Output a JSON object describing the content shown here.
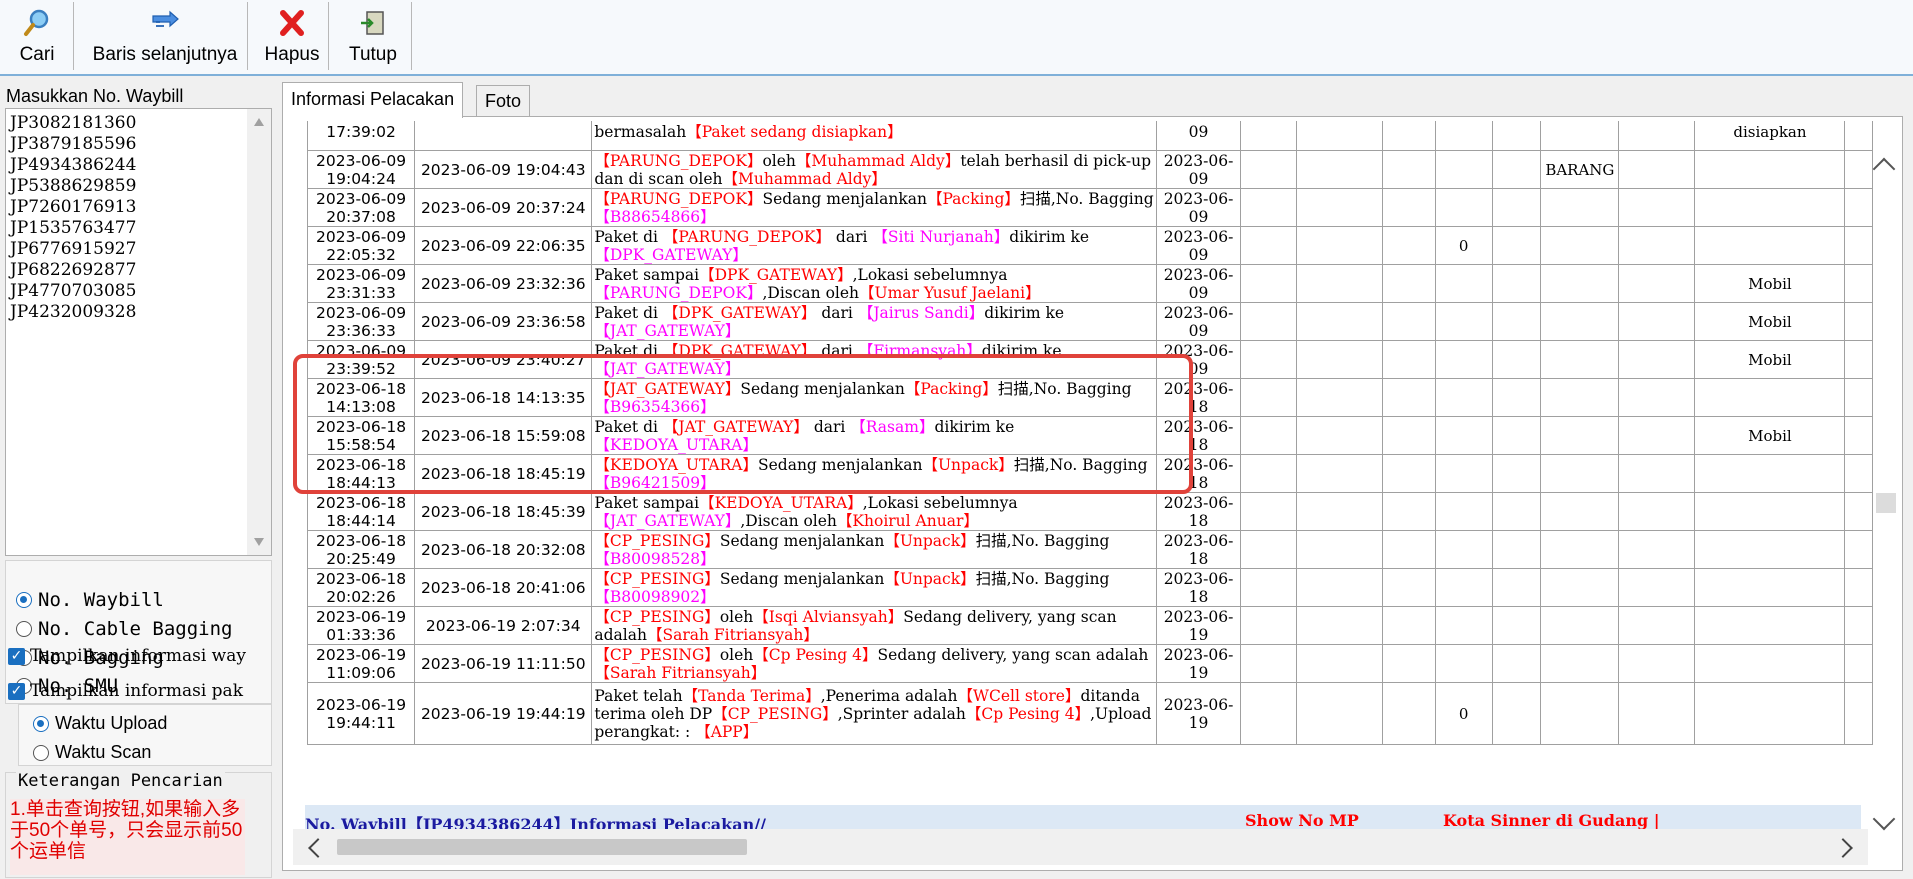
{
  "toolbar": {
    "cari": "Cari",
    "baris": "Baris selanjutnya",
    "hapus": "Hapus",
    "tutup": "Tutup"
  },
  "left": {
    "waybill_caption": "Masukkan No. Waybill",
    "waybills": [
      "JP3082181360",
      "JP3879185596",
      "JP4934386244",
      "JP5388629859",
      "JP7260176913",
      "JP1535763477",
      "JP6776915927",
      "JP6822692877",
      "JP4770703085",
      "JP4232009328"
    ],
    "radio_options": [
      "No. Waybill",
      "No. Cable Bagging",
      "No. Bagging",
      "No. SMU"
    ],
    "check1": "Tampilkan informasi way",
    "check2": "Tampilkan informasi pak",
    "time_options": [
      "Waktu Upload",
      "Waktu Scan"
    ],
    "ket_title": "Keterangan Pencarian",
    "ket_text": "1.单击查询按钮,如果输入多于50个单号，只会显示前50个运单信"
  },
  "tabs": [
    "Informasi Pelacakan",
    "Foto"
  ],
  "rows": [
    {
      "t1a": "",
      "t1b": "17:39:02",
      "t2": "",
      "desc": [
        [
          "k",
          "bermasalah"
        ],
        [
          "r",
          "【Paket sedang disiapkan】"
        ]
      ],
      "d3a": "09",
      "d3b": "",
      "ex": "disiapkan",
      "excol": 11,
      "exa": "",
      "exb": ""
    },
    {
      "t1a": "2023-06-09",
      "t1b": "19:04:24",
      "t2": "2023-06-09 19:04:43",
      "desc": [
        [
          "r",
          "【PARUNG_DEPOK】"
        ],
        [
          "k",
          "oleh"
        ],
        [
          "r",
          "【Muhammad Aldy】"
        ],
        [
          "k",
          "telah berhasil di pick-up dan di scan oleh"
        ],
        [
          "r",
          "【Muhammad Aldy】"
        ]
      ],
      "d3a": "2023-06-",
      "d3b": "09",
      "ex": "BARANG",
      "excol": 9
    },
    {
      "t1a": "2023-06-09",
      "t1b": "20:37:08",
      "t2": "2023-06-09 20:37:24",
      "desc": [
        [
          "r",
          "【PARUNG_DEPOK】"
        ],
        [
          "k",
          "Sedang menjalankan"
        ],
        [
          "r",
          "【Packing】"
        ],
        [
          "k",
          "扫描,No. Bagging"
        ],
        [
          "m",
          "【B88654866】"
        ]
      ],
      "d3a": "2023-06-",
      "d3b": "09",
      "ex": "",
      "excol": 0
    },
    {
      "t1a": "2023-06-09",
      "t1b": "22:05:32",
      "t2": "2023-06-09 22:06:35",
      "desc": [
        [
          "k",
          "Paket di "
        ],
        [
          "r",
          "【PARUNG_DEPOK】"
        ],
        [
          "k",
          " dari "
        ],
        [
          "m",
          "【Siti Nurjanah】"
        ],
        [
          "k",
          "dikirim ke"
        ],
        [
          "m",
          "【DPK_GATEWAY】"
        ]
      ],
      "d3a": "2023-06-",
      "d3b": "09",
      "ex": "0",
      "excol": 7
    },
    {
      "t1a": "2023-06-09",
      "t1b": "23:31:33",
      "t2": "2023-06-09 23:32:36",
      "desc": [
        [
          "k",
          "Paket sampai"
        ],
        [
          "r",
          "【DPK_GATEWAY】"
        ],
        [
          "k",
          ",Lokasi sebelumnya"
        ],
        [
          "m",
          "【PARUNG_DEPOK】"
        ],
        [
          "k",
          ",Discan oleh"
        ],
        [
          "r",
          "【Umar Yusuf Jaelani】"
        ]
      ],
      "d3a": "2023-06-",
      "d3b": "09",
      "ex": "Mobil",
      "excol": 11
    },
    {
      "t1a": "2023-06-09",
      "t1b": "23:36:33",
      "t2": "2023-06-09 23:36:58",
      "desc": [
        [
          "k",
          "Paket di "
        ],
        [
          "r",
          "【DPK_GATEWAY】"
        ],
        [
          "k",
          " dari "
        ],
        [
          "m",
          "【Jairus Sandi】"
        ],
        [
          "k",
          "dikirim ke"
        ],
        [
          "m",
          "【JAT_GATEWAY】"
        ]
      ],
      "d3a": "2023-06-",
      "d3b": "09",
      "ex": "Mobil",
      "excol": 11
    },
    {
      "t1a": "2023-06-09",
      "t1b": "23:39:52",
      "t2": "2023-06-09 23:40:27",
      "desc": [
        [
          "k",
          "Paket di "
        ],
        [
          "r",
          "【DPK_GATEWAY】"
        ],
        [
          "k",
          " dari "
        ],
        [
          "m",
          "【Firmansyah】"
        ],
        [
          "k",
          "dikirim ke"
        ],
        [
          "m",
          "【JAT_GATEWAY】"
        ]
      ],
      "d3a": "2023-06-",
      "d3b": "09",
      "ex": "Mobil",
      "excol": 11
    },
    {
      "t1a": "2023-06-18",
      "t1b": "14:13:08",
      "t2": "2023-06-18 14:13:35",
      "desc": [
        [
          "r",
          "【JAT_GATEWAY】"
        ],
        [
          "k",
          "Sedang menjalankan"
        ],
        [
          "r",
          "【Packing】"
        ],
        [
          "k",
          "扫描,No. Bagging"
        ],
        [
          "m",
          "【B96354366】"
        ]
      ],
      "d3a": "2023-06-",
      "d3b": "18",
      "ex": "",
      "excol": 0
    },
    {
      "t1a": "2023-06-18",
      "t1b": "15:58:54",
      "t2": "2023-06-18 15:59:08",
      "desc": [
        [
          "k",
          "Paket di "
        ],
        [
          "r",
          "【JAT_GATEWAY】"
        ],
        [
          "k",
          " dari "
        ],
        [
          "m",
          "【Rasam】"
        ],
        [
          "k",
          "dikirim ke"
        ],
        [
          "m",
          "【KEDOYA_UTARA】"
        ]
      ],
      "d3a": "2023-06-",
      "d3b": "18",
      "ex": "Mobil",
      "excol": 11
    },
    {
      "t1a": "2023-06-18",
      "t1b": "18:44:13",
      "t2": "2023-06-18 18:45:19",
      "desc": [
        [
          "r",
          "【KEDOYA_UTARA】"
        ],
        [
          "k",
          "Sedang menjalankan"
        ],
        [
          "r",
          "【Unpack】"
        ],
        [
          "k",
          "扫描,No. Bagging"
        ],
        [
          "m",
          "【B96421509】"
        ]
      ],
      "d3a": "2023-06-",
      "d3b": "18",
      "ex": "",
      "excol": 0
    },
    {
      "t1a": "2023-06-18",
      "t1b": "18:44:14",
      "t2": "2023-06-18 18:45:39",
      "desc": [
        [
          "k",
          "Paket sampai"
        ],
        [
          "r",
          "【KEDOYA_UTARA】"
        ],
        [
          "k",
          ",Lokasi sebelumnya"
        ],
        [
          "m",
          "【JAT_GATEWAY】"
        ],
        [
          "k",
          ",Discan oleh"
        ],
        [
          "r",
          "【Khoirul Anuar】"
        ]
      ],
      "d3a": "2023-06-",
      "d3b": "18",
      "ex": "",
      "excol": 0
    },
    {
      "t1a": "2023-06-18",
      "t1b": "20:25:49",
      "t2": "2023-06-18 20:32:08",
      "desc": [
        [
          "r",
          "【CP_PESING】"
        ],
        [
          "k",
          "Sedang menjalankan"
        ],
        [
          "r",
          "【Unpack】"
        ],
        [
          "k",
          "扫描,No. Bagging"
        ],
        [
          "m",
          "【B80098528】"
        ]
      ],
      "d3a": "2023-06-",
      "d3b": "18",
      "ex": "",
      "excol": 0
    },
    {
      "t1a": "2023-06-18",
      "t1b": "20:02:26",
      "t2": "2023-06-18 20:41:06",
      "desc": [
        [
          "r",
          "【CP_PESING】"
        ],
        [
          "k",
          "Sedang menjalankan"
        ],
        [
          "r",
          "【Unpack】"
        ],
        [
          "k",
          "扫描,No. Bagging"
        ],
        [
          "m",
          "【B80098902】"
        ]
      ],
      "d3a": "2023-06-",
      "d3b": "18",
      "ex": "",
      "excol": 0
    },
    {
      "t1a": "2023-06-19",
      "t1b": "01:33:36",
      "t2": "2023-06-19 2:07:34",
      "desc": [
        [
          "r",
          "【CP_PESING】"
        ],
        [
          "k",
          "oleh"
        ],
        [
          "r",
          "【Isqi Alviansyah】"
        ],
        [
          "k",
          "Sedang delivery, yang scan adalah"
        ],
        [
          "r",
          "【Sarah Fitriansyah】"
        ]
      ],
      "d3a": "2023-06-",
      "d3b": "19",
      "ex": "",
      "excol": 0
    },
    {
      "t1a": "2023-06-19",
      "t1b": "11:09:06",
      "t2": "2023-06-19 11:11:50",
      "desc": [
        [
          "r",
          "【CP_PESING】"
        ],
        [
          "k",
          "oleh"
        ],
        [
          "r",
          "【Cp Pesing 4】"
        ],
        [
          "k",
          "Sedang delivery, yang scan adalah"
        ],
        [
          "r",
          "【Sarah Fitriansyah】"
        ]
      ],
      "d3a": "2023-06-",
      "d3b": "19",
      "ex": "",
      "excol": 0
    },
    {
      "t1a": "2023-06-19",
      "t1b": "19:44:11",
      "t2": "2023-06-19 19:44:19",
      "desc": [
        [
          "k",
          "Paket telah"
        ],
        [
          "r",
          "【Tanda Terima】"
        ],
        [
          "k",
          ",Penerima adalah"
        ],
        [
          "r",
          "【WCell store】"
        ],
        [
          "k",
          "ditanda terima oleh DP"
        ],
        [
          "r",
          "【CP_PESING】"
        ],
        [
          "k",
          ",Sprinter adalah"
        ],
        [
          "r",
          "【Cp Pesing 4】"
        ],
        [
          "k",
          ",Upload perangkat: : "
        ],
        [
          "r",
          "【APP】"
        ]
      ],
      "d3a": "2023-06-",
      "d3b": "19",
      "ex": "0",
      "excol": 7
    }
  ],
  "footer": {
    "text": "No. Waybill【JP4934386244】Informasi Pelacakan//",
    "mid": "Show No MP",
    "right": "Kota Sinner di Gudang |"
  },
  "colors": {
    "red": "#ff0000",
    "magenta": "#ff00ff",
    "highlight": "#e0423a",
    "accent": "#1a6fc0"
  }
}
